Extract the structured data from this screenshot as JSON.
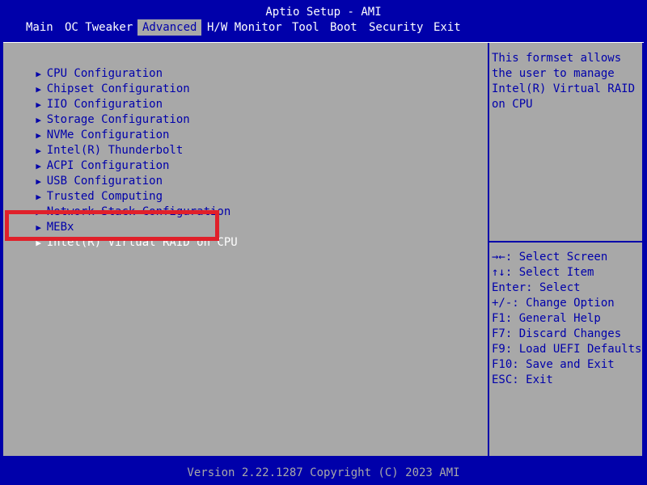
{
  "window": {
    "title": "Aptio Setup - AMI"
  },
  "menubar": {
    "tabs": [
      {
        "label": "Main",
        "active": false
      },
      {
        "label": "OC Tweaker",
        "active": false
      },
      {
        "label": "Advanced",
        "active": true
      },
      {
        "label": "H/W Monitor",
        "active": false
      },
      {
        "label": "Tool",
        "active": false
      },
      {
        "label": "Boot",
        "active": false
      },
      {
        "label": "Security",
        "active": false
      },
      {
        "label": "Exit",
        "active": false
      }
    ]
  },
  "menu": {
    "items": [
      {
        "label": "CPU Configuration"
      },
      {
        "label": "Chipset Configuration"
      },
      {
        "label": "IIO Configuration"
      },
      {
        "label": "Storage Configuration"
      },
      {
        "label": "NVMe Configuration"
      },
      {
        "label": "Intel(R) Thunderbolt"
      },
      {
        "label": "ACPI Configuration"
      },
      {
        "label": "USB Configuration"
      },
      {
        "label": "Trusted Computing"
      },
      {
        "label": "Network Stack Configuration"
      },
      {
        "label": "MEBx"
      },
      {
        "label": "Intel(R) Virtual RAID on CPU",
        "selected": true
      }
    ]
  },
  "help": {
    "text": "This formset allows the user to manage Intel(R) Virtual RAID on CPU"
  },
  "keys": [
    "→←: Select Screen",
    "↑↓: Select Item",
    "Enter: Select",
    "+/-: Change Option",
    "F1: General Help",
    "F7: Discard Changes",
    "F9: Load UEFI Defaults",
    "F10: Save and Exit",
    "ESC: Exit"
  ],
  "footer": {
    "text": "Version 2.22.1287 Copyright (C) 2023 AMI"
  },
  "colors": {
    "background": "#0000aa",
    "panel": "#a8a8a8",
    "text": "#0000aa",
    "selected_text": "#ffffff",
    "highlight_box": "#e0202a"
  }
}
